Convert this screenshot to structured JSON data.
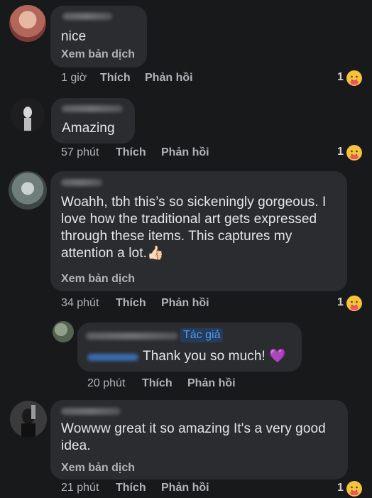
{
  "comments": [
    {
      "text": "nice",
      "translate": "Xem bản dịch",
      "time": "1 giờ",
      "like": "Thích",
      "reply": "Phản hồi",
      "reactions": "1"
    },
    {
      "text": "Amazing",
      "time": "57 phút",
      "like": "Thích",
      "reply": "Phản hồi",
      "reactions": "1"
    },
    {
      "lines": [
        "Woahh, tbh this’s so sickeningly gorgeous. I",
        "love how the traditional art gets expressed",
        "through these items. This captures my",
        "attention a lot."
      ],
      "emoji": "👍🏻",
      "translate": "Xem bản dịch",
      "time": "34 phút",
      "like": "Thích",
      "reply": "Phản hồi",
      "reactions": "1"
    },
    {
      "author_badge": "Tác giả",
      "text": "Thank you so much!",
      "emoji": "💜",
      "time": "20 phút",
      "like": "Thích",
      "reply": "Phản hồi"
    },
    {
      "lines": [
        "Wowww great it so amazing It's a very good",
        "idea."
      ],
      "translate": "Xem bản dịch",
      "time": "21 phút",
      "like": "Thích",
      "reply": "Phản hồi",
      "reactions": "1"
    }
  ],
  "icons": {
    "reaction": "care-reaction-icon"
  },
  "colors": {
    "background": "#18191b",
    "bubble": "#2b2c2f",
    "secondary_text": "#b0b3b8",
    "author_badge": "#4e9bf5"
  }
}
